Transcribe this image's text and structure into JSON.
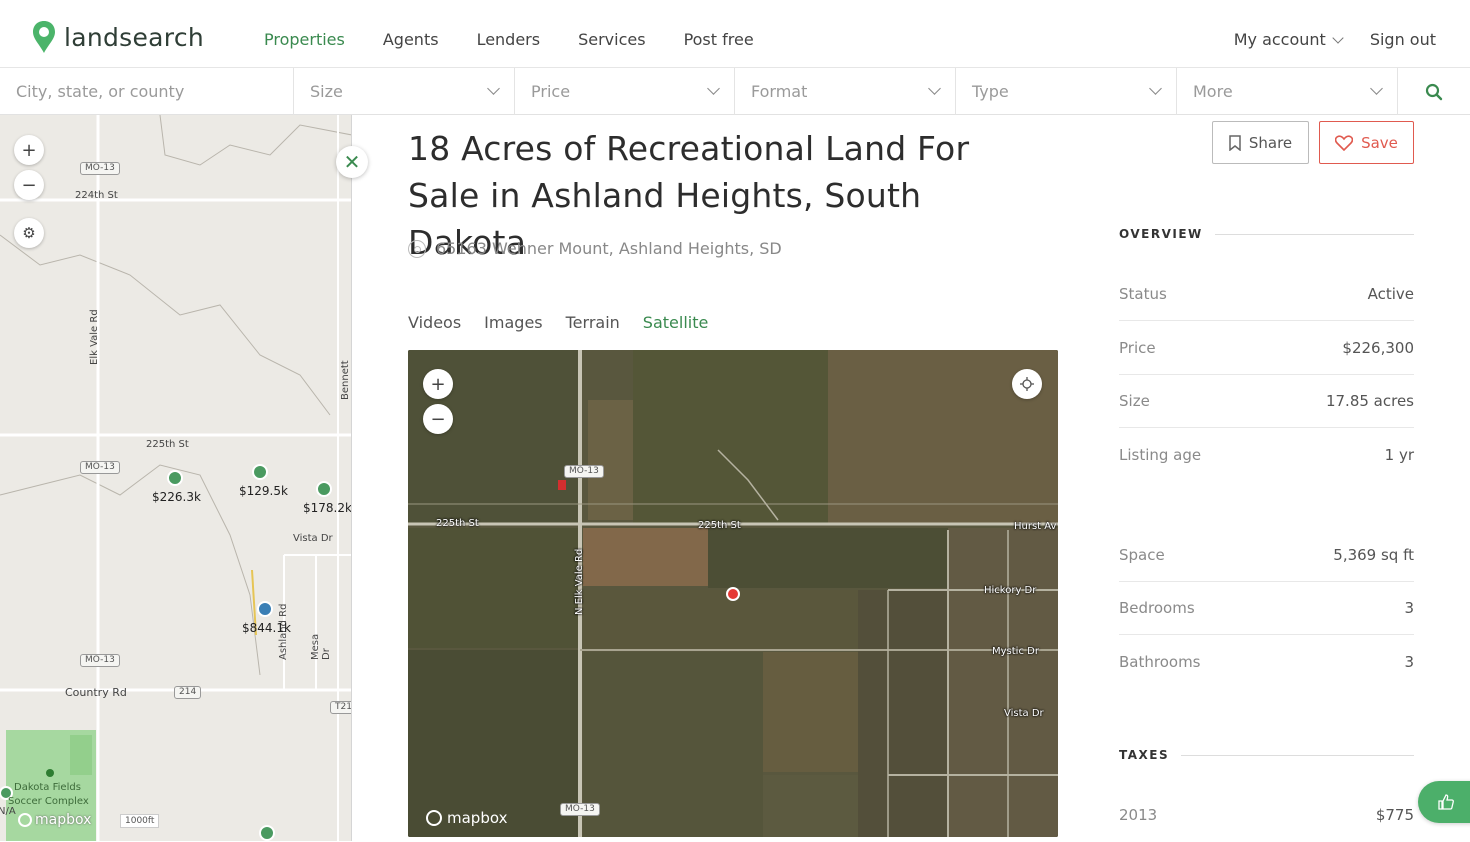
{
  "brand": {
    "name": "landsearch",
    "accent": "#3a8a4f"
  },
  "nav": {
    "items": [
      "Properties",
      "Agents",
      "Lenders",
      "Services",
      "Post free"
    ],
    "my_account": "My account",
    "sign_out": "Sign out"
  },
  "filters": {
    "location_placeholder": "City, state, or county",
    "size": "Size",
    "price": "Price",
    "format": "Format",
    "type": "Type",
    "more": "More"
  },
  "left_map": {
    "roads": [
      "224th St",
      "225th St",
      "Elk Vale Rd",
      "Bennett Rd",
      "Vista Dr",
      "Ashland Rd",
      "Mesa Dr",
      "Country Rd",
      "Dakota Fields",
      "Soccer Complex"
    ],
    "shields": [
      "MO-13",
      "MO-13",
      "MO-13",
      "214",
      "T21"
    ],
    "price_markers": [
      "$226.3k",
      "$129.5k",
      "$178.2k",
      "$844.1k"
    ],
    "scale": "1000ft",
    "attribution": "mapbox",
    "edge_text": "N/A"
  },
  "listing": {
    "title": "18 Acres of Recreational Land For Sale in Ashland Heights, South Dakota",
    "address": "65163 Wehner Mount, Ashland Heights, SD",
    "share_label": "Share",
    "save_label": "Save",
    "tabs": [
      "Videos",
      "Images",
      "Terrain",
      "Satellite"
    ],
    "active_tab": "Satellite"
  },
  "satellite": {
    "labels": [
      "225th St",
      "225th St",
      "N Elk Vale Rd",
      "MO-13",
      "MO-13",
      "Hurst Av",
      "Hickory Dr",
      "Mystic Dr",
      "Vista Dr"
    ],
    "attribution": "mapbox"
  },
  "overview": {
    "heading": "OVERVIEW",
    "rows": [
      {
        "k": "Status",
        "v": "Active"
      },
      {
        "k": "Price",
        "v": "$226,300"
      },
      {
        "k": "Size",
        "v": "17.85 acres"
      },
      {
        "k": "Listing age",
        "v": "1 yr"
      },
      {
        "k": "Space",
        "v": "5,369 sq ft"
      },
      {
        "k": "Bedrooms",
        "v": "3"
      },
      {
        "k": "Bathrooms",
        "v": "3"
      }
    ]
  },
  "taxes": {
    "heading": "TAXES",
    "rows": [
      {
        "k": "2013",
        "v": "$775"
      }
    ]
  }
}
